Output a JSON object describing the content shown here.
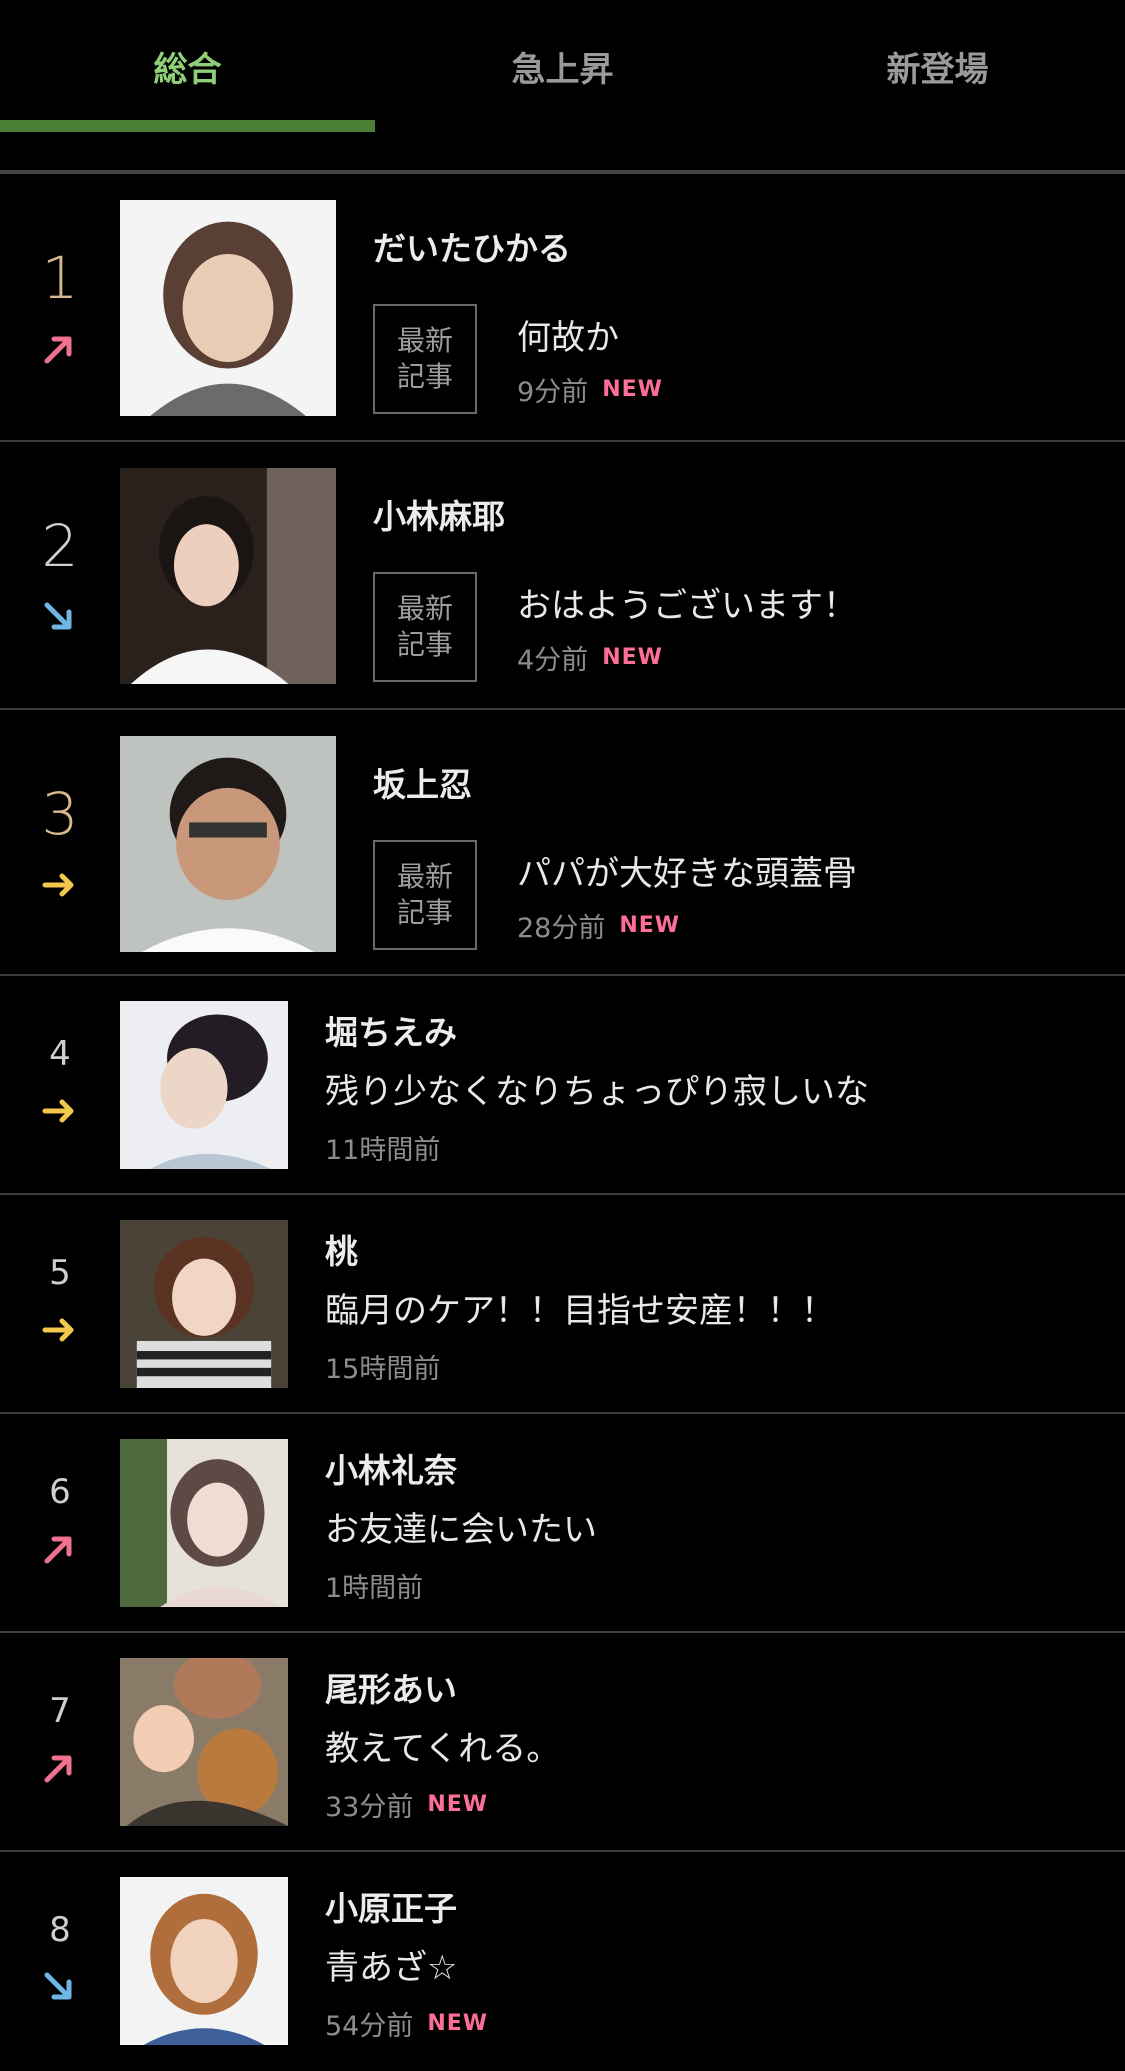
{
  "tabs": [
    {
      "label": "総合",
      "active": true
    },
    {
      "label": "急上昇",
      "active": false
    },
    {
      "label": "新登場",
      "active": false
    }
  ],
  "colors": {
    "up": "#f0708e",
    "down": "#6fb6e6",
    "flat": "#f2c94c",
    "accent": "#8fcf78",
    "new": "#ff6e97"
  },
  "badge_label_line1": "最新",
  "badge_label_line2": "記事",
  "new_label": "NEW",
  "ranking": [
    {
      "rank": "1",
      "trend": "up",
      "name": "だいたひかる",
      "title": "何故か",
      "time": "9分前",
      "is_new": true
    },
    {
      "rank": "2",
      "trend": "down",
      "name": "小林麻耶",
      "title": "おはようございます！",
      "time": "4分前",
      "is_new": true
    },
    {
      "rank": "3",
      "trend": "flat",
      "name": "坂上忍",
      "title": "パパが大好きな頭蓋骨",
      "time": "28分前",
      "is_new": true
    },
    {
      "rank": "4",
      "trend": "flat",
      "name": "堀ちえみ",
      "title": "残り少なくなりちょっぴり寂しいな",
      "time": "11時間前",
      "is_new": false
    },
    {
      "rank": "5",
      "trend": "flat",
      "name": "桃",
      "title": "臨月のケア！！目指せ安産！！！",
      "time": "15時間前",
      "is_new": false
    },
    {
      "rank": "6",
      "trend": "up",
      "name": "小林礼奈",
      "title": "お友達に会いたい",
      "time": "1時間前",
      "is_new": false
    },
    {
      "rank": "7",
      "trend": "up",
      "name": "尾形あい",
      "title": "教えてくれる。",
      "time": "33分前",
      "is_new": true
    },
    {
      "rank": "8",
      "trend": "down",
      "name": "小原正子",
      "title": "青あざ☆",
      "time": "54分前",
      "is_new": true
    }
  ]
}
